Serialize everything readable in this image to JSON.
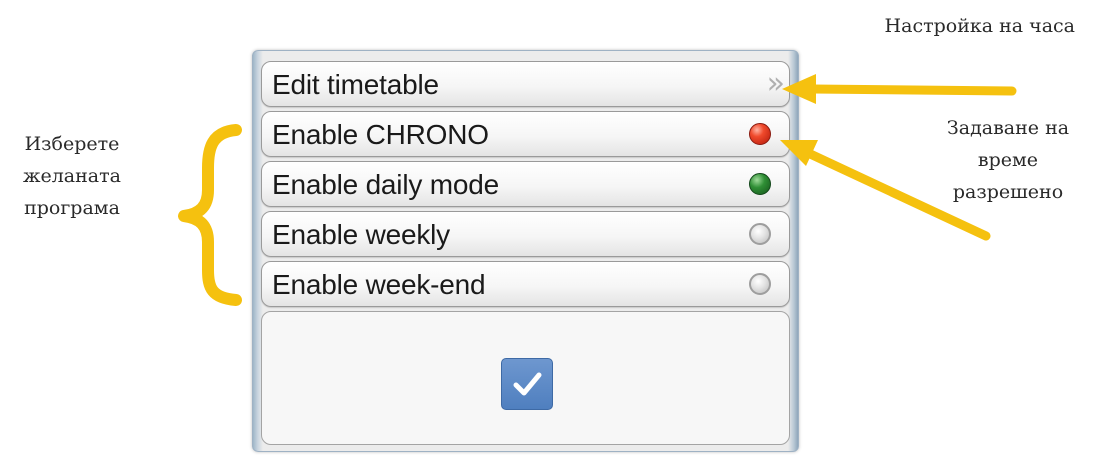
{
  "menu": {
    "items": [
      {
        "label": "Edit timetable",
        "indicator": "chevron-right-double"
      },
      {
        "label": "Enable CHRONO",
        "indicator": "led-red",
        "state_color": "#e8402a"
      },
      {
        "label": "Enable daily mode",
        "indicator": "led-green",
        "state_color": "#2e7d32"
      },
      {
        "label": "Enable weekly",
        "indicator": "led-off",
        "state_color": "#d0d0d0"
      },
      {
        "label": "Enable week-end",
        "indicator": "led-off",
        "state_color": "#d0d0d0"
      }
    ],
    "confirm_icon": "checkmark-icon",
    "confirm_color": "#5583c4",
    "chevron_glyph": "»"
  },
  "annotations": {
    "top_right": "Настройка на часа",
    "right": [
      "Задаване на",
      "време",
      "разрешено"
    ],
    "left": [
      "Изберете",
      "желаната",
      "програма"
    ],
    "accent_color": "#f5c10f"
  }
}
